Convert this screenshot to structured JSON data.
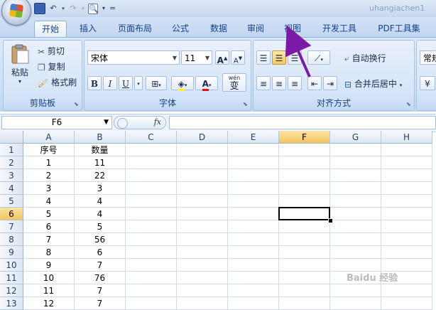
{
  "window": {
    "title_partial": "uhangiachen1"
  },
  "tabs": [
    {
      "label": "开始",
      "active": true
    },
    {
      "label": "插入"
    },
    {
      "label": "页面布局"
    },
    {
      "label": "公式"
    },
    {
      "label": "数据"
    },
    {
      "label": "审阅"
    },
    {
      "label": "视图"
    },
    {
      "label": "开发工具"
    },
    {
      "label": "PDF工具集"
    }
  ],
  "clipboard": {
    "paste": "粘贴",
    "cut": "剪切",
    "copy": "复制",
    "format_painter": "格式刷",
    "label": "剪贴板"
  },
  "font": {
    "name": "宋体",
    "size": "11",
    "grow": "A",
    "shrink": "A",
    "bold": "B",
    "italic": "I",
    "underline": "U",
    "font_color": "A",
    "phonetic_top": "wén",
    "phonetic": "变",
    "label": "字体"
  },
  "alignment": {
    "wrap_text": "自动换行",
    "merge_center": "合并后居中",
    "label": "对齐方式"
  },
  "number": {
    "format": "常规"
  },
  "formula_bar": {
    "name_box": "F6",
    "fx": "fx",
    "content": ""
  },
  "sheet": {
    "columns": [
      "A",
      "B",
      "C",
      "D",
      "E",
      "F",
      "G",
      "H"
    ],
    "active_col": "F",
    "active_row": 6,
    "rows": [
      {
        "n": "1",
        "a": "序号",
        "b": "数量"
      },
      {
        "n": "2",
        "a": "1",
        "b": "11"
      },
      {
        "n": "3",
        "a": "2",
        "b": "22"
      },
      {
        "n": "4",
        "a": "3",
        "b": "3"
      },
      {
        "n": "5",
        "a": "4",
        "b": "4"
      },
      {
        "n": "6",
        "a": "5",
        "b": "4"
      },
      {
        "n": "7",
        "a": "6",
        "b": "5"
      },
      {
        "n": "8",
        "a": "7",
        "b": "56"
      },
      {
        "n": "9",
        "a": "8",
        "b": "6"
      },
      {
        "n": "10",
        "a": "9",
        "b": "7"
      },
      {
        "n": "11",
        "a": "10",
        "b": "76"
      },
      {
        "n": "12",
        "a": "11",
        "b": "7"
      },
      {
        "n": "13",
        "a": "12",
        "b": "7"
      }
    ]
  },
  "watermark": "Baidu 经验",
  "colors": {
    "arrow": "#7a1aa6",
    "ribbon": "#cfe0f6",
    "tab_text": "#15428b"
  }
}
